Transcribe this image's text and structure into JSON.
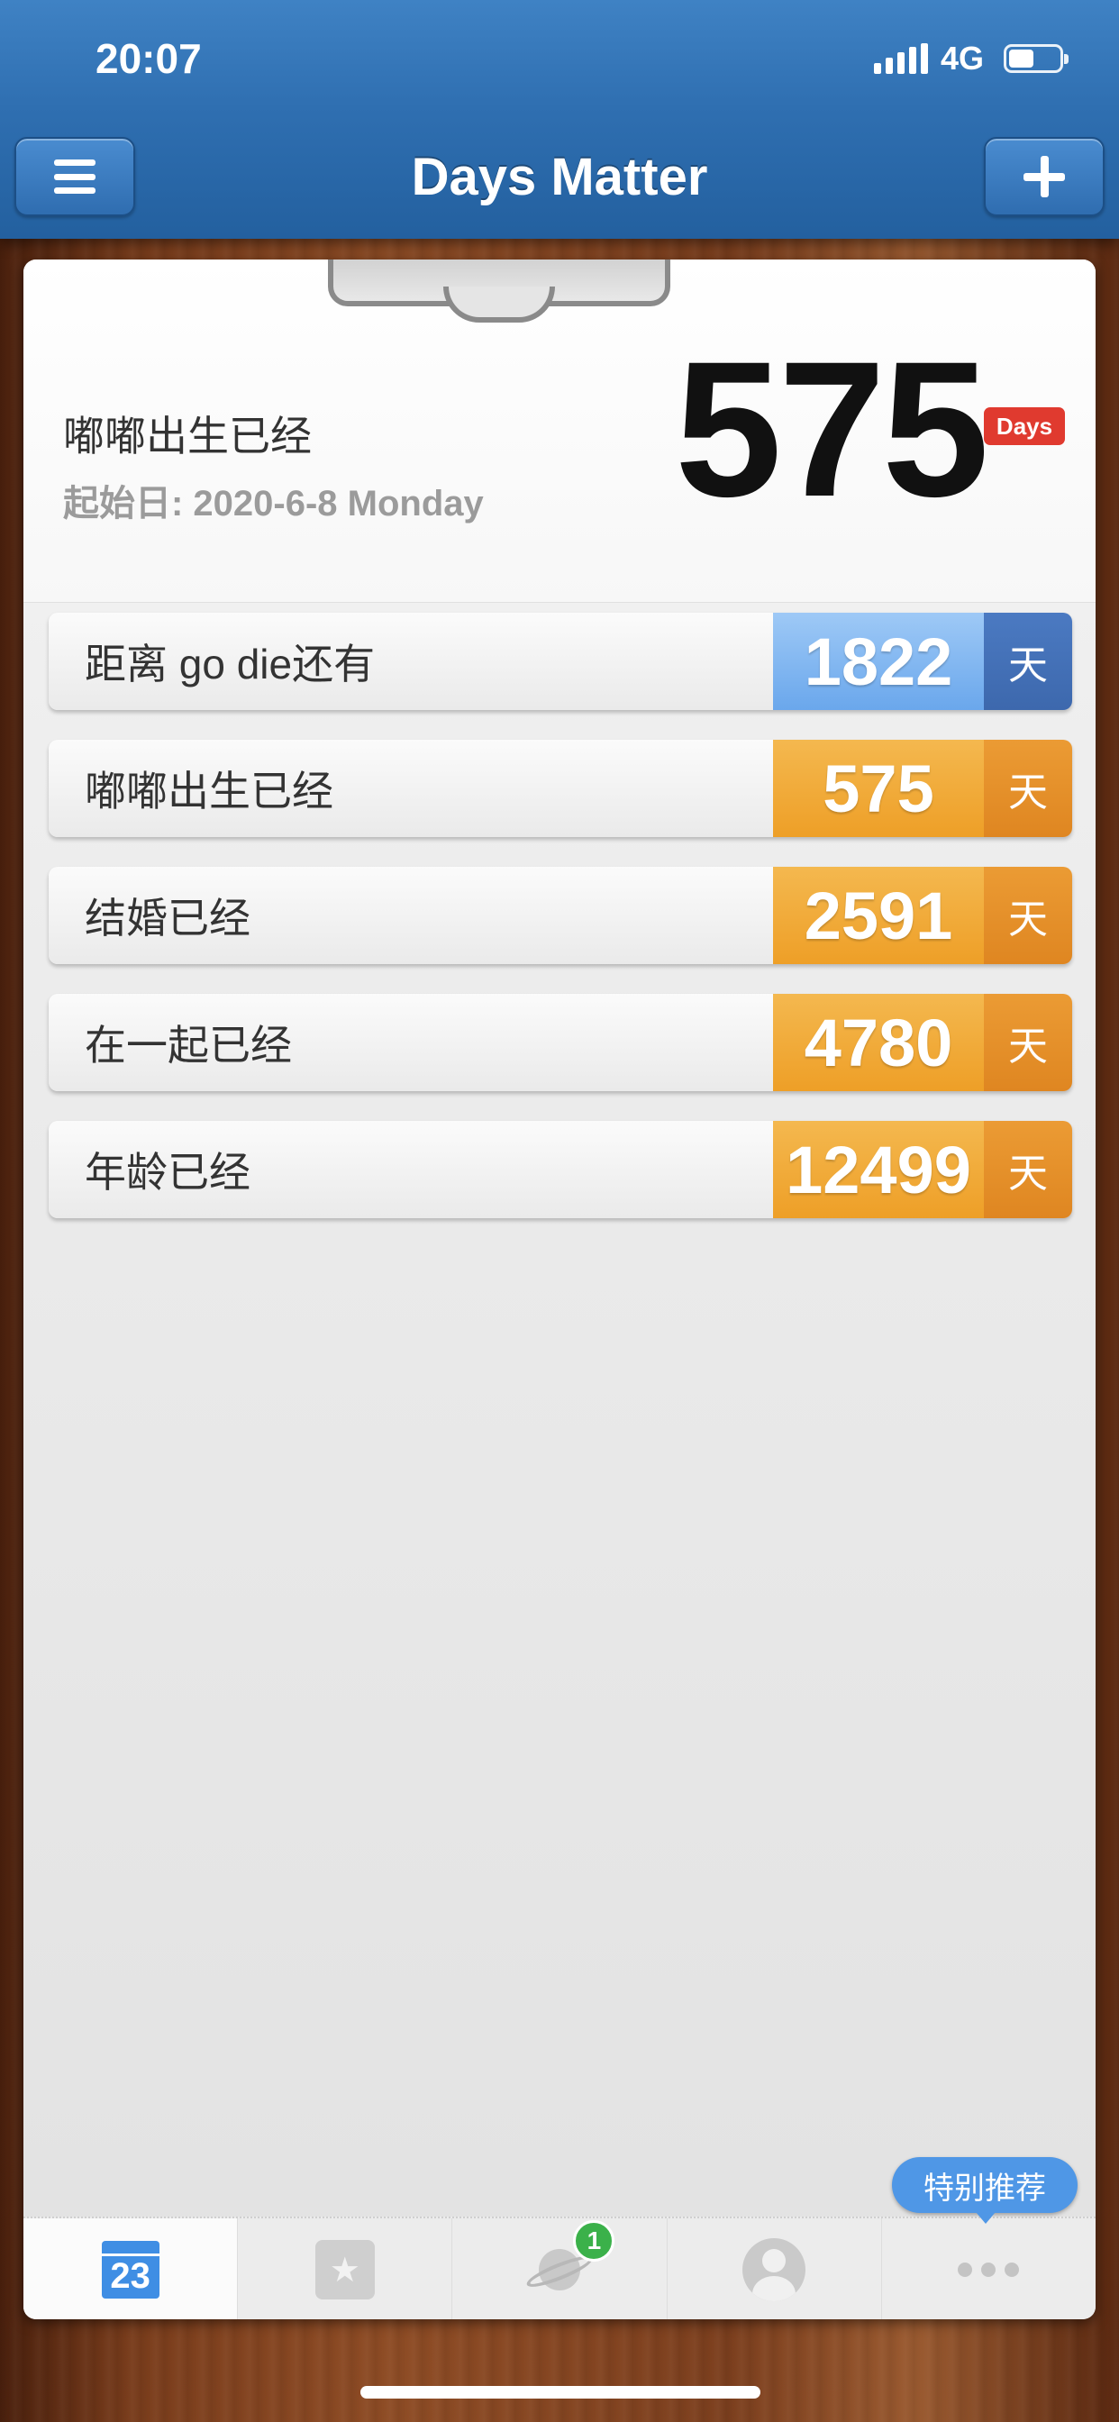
{
  "status_bar": {
    "time": "20:07",
    "network": "4G",
    "battery_level": 0.5
  },
  "nav": {
    "title": "Days Matter"
  },
  "hero": {
    "title": "嘟嘟出生已经",
    "start_date": "起始日: 2020-6-8 Monday",
    "count": "575",
    "unit_badge": "Days"
  },
  "events": [
    {
      "label": "距离 go die还有",
      "count": "1822",
      "unit": "天",
      "type": "future",
      "color": "#6aa7ec"
    },
    {
      "label": "嘟嘟出生已经",
      "count": "575",
      "unit": "天",
      "type": "past",
      "color": "#ee9f27"
    },
    {
      "label": "结婚已经",
      "count": "2591",
      "unit": "天",
      "type": "past",
      "color": "#ee9f27"
    },
    {
      "label": "在一起已经",
      "count": "4780",
      "unit": "天",
      "type": "past",
      "color": "#ee9f27"
    },
    {
      "label": "年龄已经",
      "count": "12499",
      "unit": "天",
      "type": "past",
      "color": "#ee9f27"
    }
  ],
  "tabbar": {
    "tabs": [
      {
        "icon": "calendar-icon",
        "text": "23",
        "active": true
      },
      {
        "icon": "star-notebook-icon",
        "text": "★",
        "active": false
      },
      {
        "icon": "planet-icon",
        "badge": "1",
        "active": false
      },
      {
        "icon": "user-icon",
        "active": false
      },
      {
        "icon": "more-dots-icon",
        "active": false
      }
    ],
    "recommend_label": "特别推荐"
  },
  "colors": {
    "accent_blue": "#2f6fb1",
    "future_blue": "#6aa7ec",
    "past_orange": "#ee9f27",
    "badge_red": "#e03a2f",
    "badge_green": "#3bb14a"
  }
}
